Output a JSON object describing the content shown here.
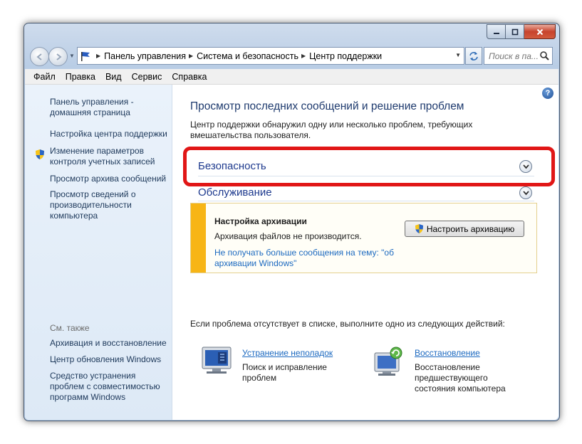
{
  "window": {
    "breadcrumb": [
      "Панель управления",
      "Система и безопасность",
      "Центр поддержки"
    ],
    "search_placeholder": "Поиск в па..."
  },
  "menu": [
    "Файл",
    "Правка",
    "Вид",
    "Сервис",
    "Справка"
  ],
  "sidebar": {
    "links": [
      "Панель управления - домашняя страница",
      "Настройка центра поддержки",
      "Изменение параметров контроля учетных записей",
      "Просмотр архива сообщений",
      "Просмотр сведений о производительности компьютера"
    ],
    "see_also_title": "См. также",
    "see_also": [
      "Архивация и восстановление",
      "Центр обновления Windows",
      "Средство устранения проблем с совместимостью программ Windows"
    ]
  },
  "main": {
    "title": "Просмотр последних сообщений и решение проблем",
    "description": "Центр поддержки обнаружил одну или несколько проблем, требующих вмешательства пользователя.",
    "security_label": "Безопасность",
    "maintenance_label": "Обслуживание",
    "alert": {
      "title": "Настройка архивации",
      "text": "Архивация файлов не производится.",
      "link": "Не получать больше сообщения на тему: \"об архивации Windows\"",
      "button": "Настроить архивацию",
      "color": "#f7b516"
    },
    "if_problem": "Если проблема отсутствует в списке, выполните одно из следующих действий:",
    "actions": [
      {
        "title": "Устранение неполадок",
        "desc": "Поиск и исправление проблем"
      },
      {
        "title": "Восстановление",
        "desc": "Восстановление предшествующего состояния компьютера"
      }
    ]
  },
  "colors": {
    "highlight": "#e11616",
    "link": "#1d6ac0",
    "heading": "#1e3a6e"
  }
}
